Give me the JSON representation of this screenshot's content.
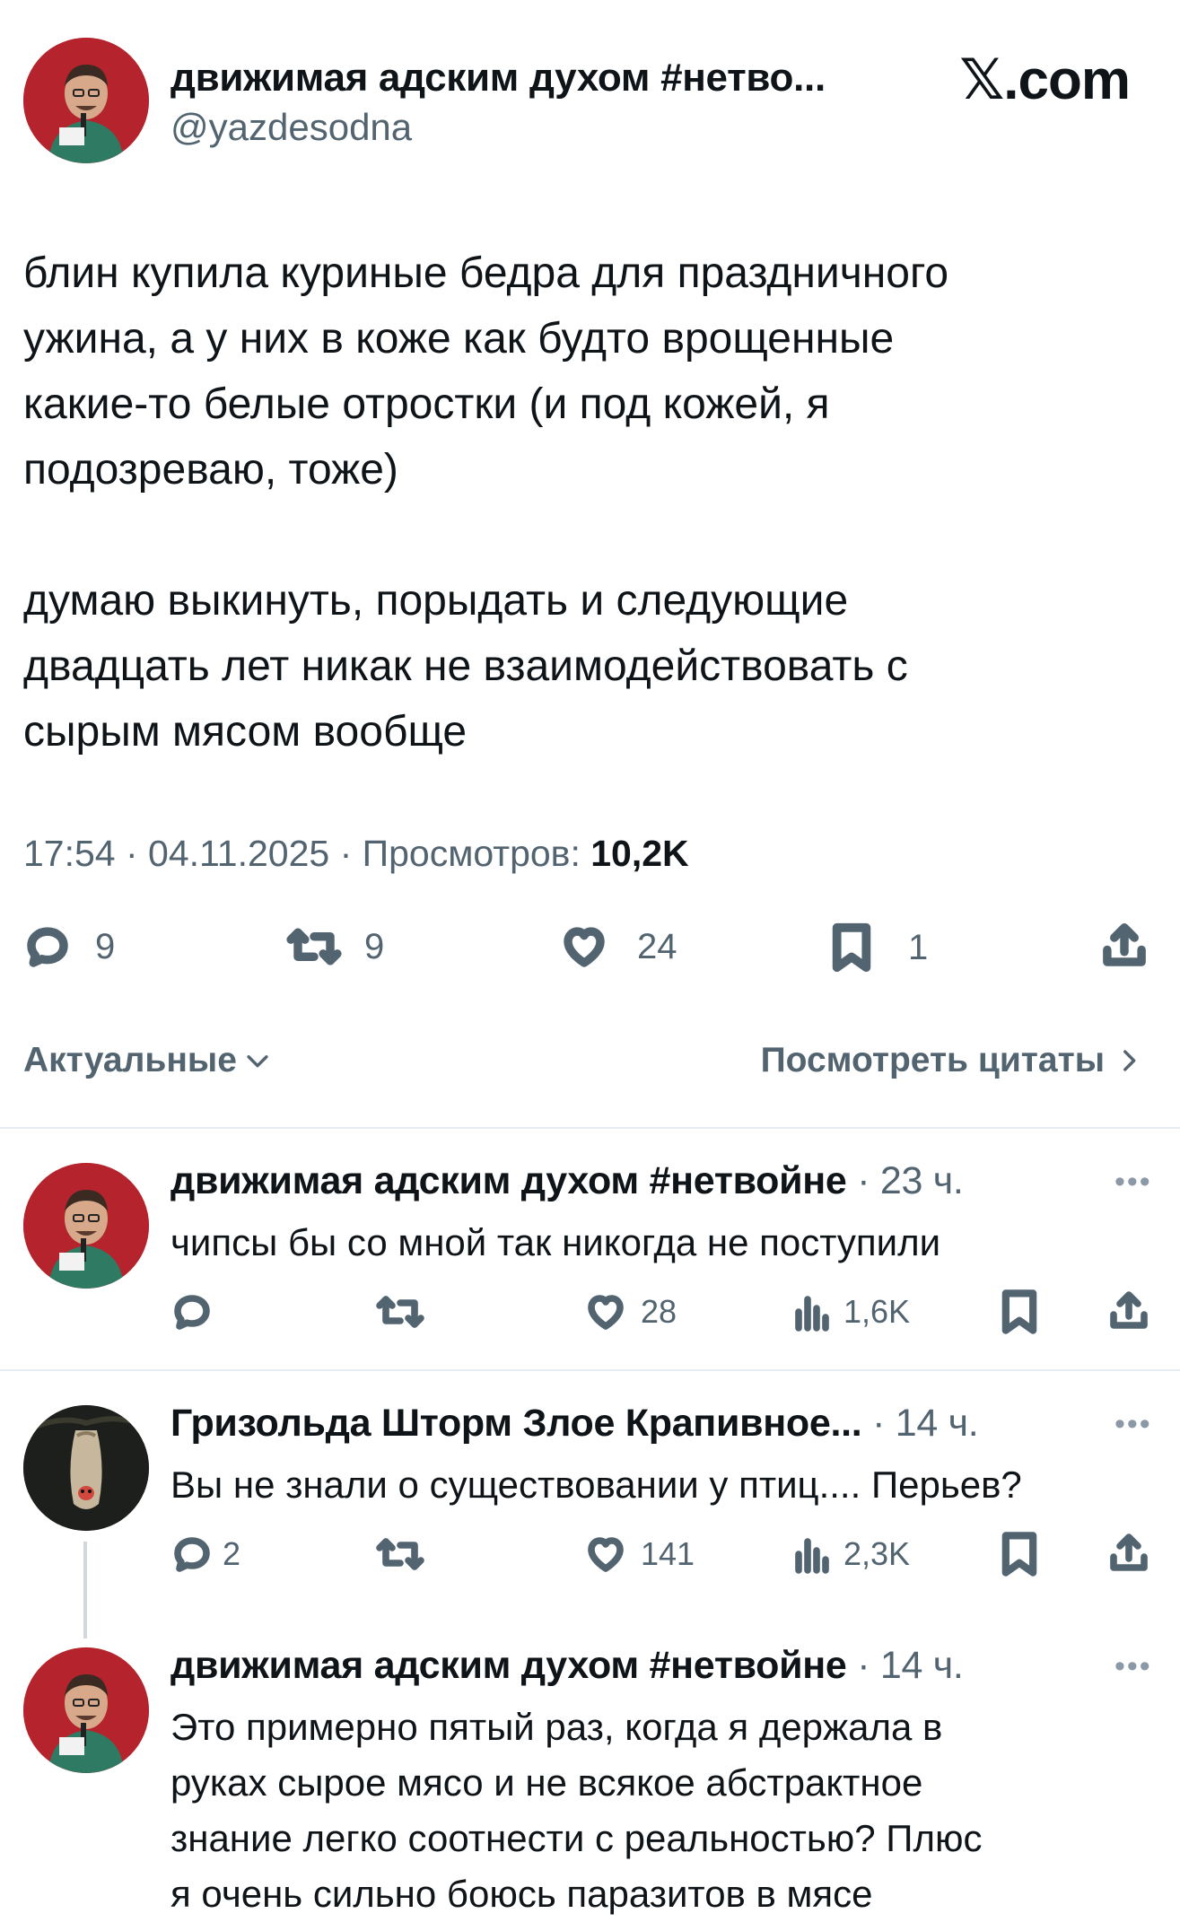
{
  "header": {
    "display_name": "движимая адским духом #нетво...",
    "handle": "@yazdesodna",
    "brand": "𝕏.com"
  },
  "tweet": {
    "text": "блин купила куриные бедра для праздничного\nужина, а у них в коже как будто врощенные\nкакие-то белые отростки (и под кожей, я\nподозреваю, тоже)\n\nдумаю выкинуть, порыдать и следующие\nдвадцать лет никак не взаимодействовать с\nсырым мясом вообще",
    "time_date": "17:54 · 04.11.2025 · Просмотров: ",
    "views": "10,2K",
    "counts": {
      "replies": "9",
      "reposts": "9",
      "likes": "24",
      "bookmarks": "1"
    }
  },
  "filter_label": "Актуальные",
  "quotes_label": "Посмотреть цитаты",
  "replies": [
    {
      "name": "движимая адским духом #нетвойне",
      "time": " · 23 ч.",
      "text": "чипсы бы со мной так никогда не поступили",
      "replies": "",
      "likes": "28",
      "views": "1,6K",
      "avatar": "avatar-red"
    },
    {
      "name": "Гризольда Шторм Злое Крапивное...",
      "time": " · 14 ч.",
      "text": "Вы не знали о существовании у птиц.... Перьев?",
      "replies": "2",
      "likes": "141",
      "views": "2,3K",
      "avatar": "avatar-bat"
    },
    {
      "name": "движимая адским духом #нетвойне",
      "time": " · 14 ч.",
      "text": "Это примерно пятый раз, когда я держала в\nруках сырое мясо и не всякое абстрактное\nзнание легко соотнести с реальностью? Плюс\nя очень сильно боюсь паразитов в мясе",
      "avatar": "avatar-red"
    }
  ],
  "icons": {
    "reply": "reply-icon",
    "repost": "repost-icon",
    "like": "heart-icon",
    "bookmark": "bookmark-icon",
    "share": "share-icon",
    "views": "views-icon",
    "more": "more-icon"
  },
  "colors": {
    "text": "#0f1419",
    "secondary": "#536471",
    "divider": "#e6ecf0",
    "avatar_bg": "#b5232d"
  }
}
